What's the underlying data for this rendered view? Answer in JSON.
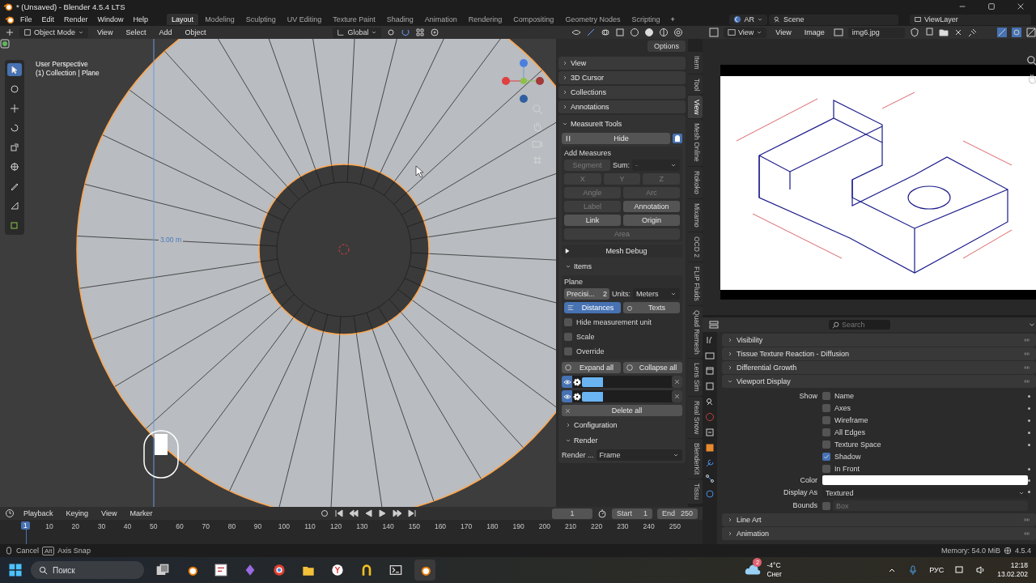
{
  "title_bar": {
    "title": "* (Unsaved) - Blender 4.5.4 LTS"
  },
  "menu_bar": {
    "menus": [
      "File",
      "Edit",
      "Render",
      "Window",
      "Help"
    ],
    "workspaces": [
      {
        "label": "Layout",
        "selected": true
      },
      {
        "label": "Modeling",
        "selected": false
      },
      {
        "label": "Sculpting",
        "selected": false
      },
      {
        "label": "UV Editing",
        "selected": false
      },
      {
        "label": "Texture Paint",
        "selected": false
      },
      {
        "label": "Shading",
        "selected": false
      },
      {
        "label": "Animation",
        "selected": false
      },
      {
        "label": "Rendering",
        "selected": false
      },
      {
        "label": "Compositing",
        "selected": false
      },
      {
        "label": "Geometry Nodes",
        "selected": false
      },
      {
        "label": "Scripting",
        "selected": false
      }
    ],
    "add_tab": "+",
    "pipeline": "AR",
    "scene": "Scene",
    "view_layer": "ViewLayer"
  },
  "viewport": {
    "mode": "Object Mode",
    "menus": [
      "View",
      "Select",
      "Add",
      "Object"
    ],
    "orientation": "Global",
    "options": "Options",
    "view_name": "User Perspective",
    "object_info": "(1) Collection | Plane",
    "measure_label": "3.00 m"
  },
  "n_panel": {
    "collapsed": [
      "View",
      "3D Cursor",
      "Collections",
      "Annotations"
    ],
    "measureit": {
      "title": "MeasureIt Tools",
      "hide": "Hide",
      "add_title": "Add Measures",
      "rows": [
        [
          {
            "kind": "button",
            "label": "Segment",
            "disabled": true
          },
          {
            "kind": "label",
            "label": "Sum:"
          },
          {
            "kind": "dropdown",
            "label": "-",
            "disabled": true
          }
        ],
        [
          {
            "kind": "button",
            "label": "X",
            "disabled": true
          },
          {
            "kind": "button",
            "label": "Y",
            "disabled": true
          },
          {
            "kind": "button",
            "label": "Z",
            "disabled": true
          }
        ],
        [
          {
            "kind": "button",
            "label": "Angle",
            "disabled": true
          },
          {
            "kind": "button",
            "label": "Arc",
            "disabled": true
          }
        ],
        [
          {
            "kind": "button",
            "label": "Label",
            "disabled": true
          },
          {
            "kind": "button",
            "label": "Annotation",
            "disabled": false
          }
        ],
        [
          {
            "kind": "button",
            "label": "Link",
            "disabled": false
          },
          {
            "kind": "button",
            "label": "Origin",
            "disabled": false
          }
        ],
        [
          {
            "kind": "button",
            "label": "Area",
            "disabled": true
          }
        ]
      ],
      "mesh_debug": "Mesh Debug",
      "items": {
        "title": "Items",
        "expanded": true,
        "object": "Plane",
        "precision_label": "Precisi...",
        "precision": "2",
        "units_label": "Units:",
        "units": "Meters",
        "toggles": [
          {
            "label": "Distances",
            "selected": true
          },
          {
            "label": "Texts",
            "selected": false
          }
        ],
        "checkboxes": [
          {
            "label": "Hide measurement unit",
            "checked": false
          },
          {
            "label": "Scale",
            "checked": false
          },
          {
            "label": "Override",
            "checked": false
          }
        ],
        "expand_all": "Expand all",
        "collapse_all": "Collapse all",
        "measures": [
          {
            "visible": true,
            "color": "#6ab4f2"
          },
          {
            "visible": true,
            "color": "#6ab4f2"
          }
        ],
        "delete_all": "Delete all"
      },
      "configuration": {
        "title": "Configuration",
        "expanded": false
      },
      "render": {
        "title": "Render",
        "expanded": true,
        "label": "Render ...",
        "value": "Frame"
      }
    },
    "tabs": [
      {
        "label": "Item",
        "selected": false
      },
      {
        "label": "Tool",
        "selected": false
      },
      {
        "label": "View",
        "selected": true
      },
      {
        "label": "Mesh Online",
        "selected": false
      },
      {
        "label": "Rokoko",
        "selected": false
      },
      {
        "label": "Mixamo",
        "selected": false
      },
      {
        "label": "OCD 2",
        "selected": false
      },
      {
        "label": "FLIP Fluids",
        "selected": false
      },
      {
        "label": "Quad Remesh",
        "selected": false
      },
      {
        "label": "Lens Sim",
        "selected": false
      },
      {
        "label": "Real Snow",
        "selected": false
      },
      {
        "label": "BlenderKit",
        "selected": false
      },
      {
        "label": "Tissu",
        "selected": false
      }
    ]
  },
  "image_editor": {
    "mode": "View",
    "menus": [
      "View",
      "Image"
    ],
    "image_name": "img6.jpg"
  },
  "properties": {
    "search_placeholder": "Search",
    "panels": [
      {
        "title": "Visibility",
        "expanded": false
      },
      {
        "title": "Tissue Texture Reaction - Diffusion",
        "expanded": false
      },
      {
        "title": "Differential Growth",
        "expanded": false
      },
      {
        "title": "Viewport Display",
        "expanded": true
      },
      {
        "title": "Line Art",
        "expanded": false
      },
      {
        "title": "Animation",
        "expanded": false
      }
    ],
    "viewport_display": {
      "show_label": "Show",
      "show": [
        {
          "label": "Name",
          "checked": false
        },
        {
          "label": "Axes",
          "checked": false
        },
        {
          "label": "Wireframe",
          "checked": false
        },
        {
          "label": "All Edges",
          "checked": false
        },
        {
          "label": "Texture Space",
          "checked": false
        },
        {
          "label": "Shadow",
          "checked": true
        },
        {
          "label": "In Front",
          "checked": false
        }
      ],
      "color_label": "Color",
      "color": "#ffffff",
      "display_as_label": "Display As",
      "display_as": "Textured",
      "bounds_label": "Bounds",
      "bounds_checked": false,
      "bounds_type": "Box"
    }
  },
  "timeline": {
    "menus": [
      "Playback",
      "Keying",
      "View",
      "Marker"
    ],
    "current_frame": "1",
    "start_label": "Start",
    "start": "1",
    "end_label": "End",
    "end": "250",
    "ruler_current": "1",
    "ticks": [
      "10",
      "20",
      "30",
      "40",
      "50",
      "60",
      "70",
      "80",
      "90",
      "100",
      "110",
      "120",
      "130",
      "140",
      "150",
      "160",
      "170",
      "180",
      "190",
      "200",
      "210",
      "220",
      "230",
      "240",
      "250"
    ]
  },
  "status_bar": {
    "cancel": "Cancel",
    "key": "Alt",
    "axis_snap": "Axis Snap",
    "memory": "Memory: 54.0 MiB",
    "version": "4.5.4"
  },
  "taskbar": {
    "search_placeholder": "Поиск",
    "weather_badge": "2",
    "temperature": "-4°C",
    "condition": "Снег",
    "language": "РУС",
    "time": "12:18",
    "date": "13.02.202"
  }
}
